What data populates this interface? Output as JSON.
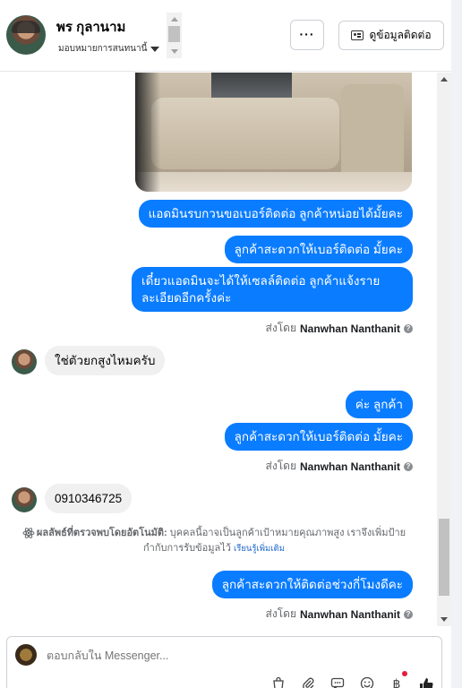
{
  "header": {
    "contact_name": "พร กุลานาม",
    "assign_label": "มอบหมายการสนทนานี้",
    "more_label": "···",
    "contact_info_label": "ดูข้อมูลติดต่อ"
  },
  "messages": [
    {
      "type": "out",
      "text": "แอดมินรบกวนขอเบอร์ติดต่อ ลูกค้าหน่อยได้มั้ยคะ"
    },
    {
      "type": "out",
      "text": "ลูกค้าสะดวกให้เบอร์ติดต่อ มั้ยคะ"
    },
    {
      "type": "out",
      "text": "เดี๋ยวแอดมินจะได้ให้เซลล์ติดต่อ ลูกค้าแจ้งราย ละเอียดอีกครั้งค่ะ"
    },
    {
      "type": "in",
      "text": "ใช่ตัวยกสูงไหมครับ"
    },
    {
      "type": "out",
      "text": "ค่ะ ลูกค้า"
    },
    {
      "type": "out",
      "text": "ลูกค้าสะดวกให้เบอร์ติดต่อ มั้ยคะ"
    },
    {
      "type": "in",
      "text": "0910346725"
    },
    {
      "type": "out",
      "text": "ลูกค้าสะดวกให้ติดต่อช่วงกี่โมงดีคะ"
    }
  ],
  "sent_by": {
    "prefix": "ส่งโดย",
    "name": "Nanwhan Nanthanit"
  },
  "auto_detect": {
    "title": "ผลลัพธ์ที่ตรวจพบโดยอัตโนมัติ:",
    "body": "บุคคลนี้อาจเป็นลูกค้าเป้าหมายคุณภาพสูง เราจึงเพิ่มป้ายกำกับการรับข้อมูลไว้",
    "learn_more": "เรียนรู้เพิ่มเติม"
  },
  "composer": {
    "placeholder": "ตอบกลับใน Messenger..."
  },
  "colors": {
    "outgoing_bubble": "#0a7cff",
    "incoming_bubble": "#f0f0f0",
    "notification_dot": "#e41e3f"
  }
}
